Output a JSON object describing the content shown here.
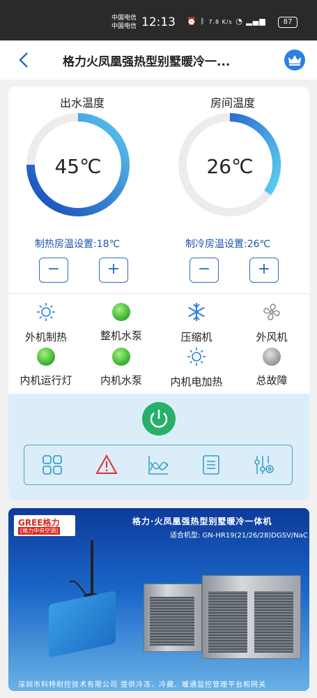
{
  "status_bar": {
    "carrier_1": "中国电信",
    "carrier_2": "中国电信",
    "time": "12:13",
    "net_speed": "7.8 K/s",
    "battery": "87"
  },
  "header": {
    "title": "格力火凤凰强热型别墅暖冷一...",
    "back_icon": "chevron-left-icon",
    "vip_icon": "crown-icon"
  },
  "gauges": {
    "outlet": {
      "label": "出水温度",
      "value": "45℃",
      "setting": "制热房温设置:18℃",
      "minus": "−",
      "plus": "+"
    },
    "room": {
      "label": "房间温度",
      "value": "26℃",
      "setting": "制冷房温设置:26℃",
      "minus": "−",
      "plus": "+"
    }
  },
  "status_items": [
    {
      "label": "外机制热",
      "icon": "sun-icon"
    },
    {
      "label": "整机水泵",
      "icon": "green-ball-icon"
    },
    {
      "label": "压缩机",
      "icon": "snowflake-icon"
    },
    {
      "label": "外风机",
      "icon": "fan-icon"
    },
    {
      "label": "内机运行灯",
      "icon": "green-ball-icon"
    },
    {
      "label": "内机水泵",
      "icon": "green-ball-icon"
    },
    {
      "label": "内机电加热",
      "icon": "sun-icon"
    },
    {
      "label": "总故障",
      "icon": "gray-ball-icon"
    }
  ],
  "toolbar": {
    "icons": [
      "grid-icon",
      "warning-icon",
      "chart-icon",
      "list-icon",
      "settings-sliders-icon"
    ]
  },
  "banner": {
    "brand_en": "GREE格力",
    "brand_cn": "[格力中央空调]",
    "title": "格力·火凤凰强热型别墅暖冷一体机",
    "model": "适合机型: GN-HR19(21/26/28)DGSV/NaC",
    "footer": "深圳市科特耐控技术有限公司  提供冷冻、冷藏、暖通监控管理平台和网关"
  },
  "colors": {
    "accent_blue": "#2a6cc4",
    "power_green": "#27b06a",
    "status_green": "#3fb83a",
    "gray": "#a0a0a0",
    "warning_red": "#e0302a"
  }
}
